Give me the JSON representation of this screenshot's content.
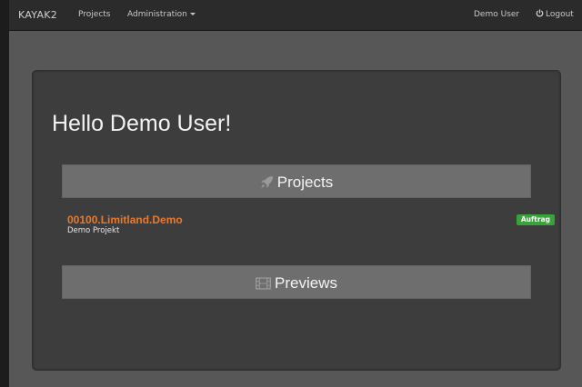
{
  "navbar": {
    "brand": "KAYAK2",
    "links": {
      "projects": "Projects",
      "administration": "Administration"
    },
    "user": "Demo User",
    "logout": "Logout"
  },
  "main": {
    "greeting": "Hello Demo User!",
    "projects_section": {
      "label": "Projects",
      "icon": "rocket-icon"
    },
    "projects": [
      {
        "title": "00100.Limitland.Demo",
        "subtitle": "Demo Projekt",
        "status": "Auftrag"
      }
    ],
    "previews_section": {
      "label": "Previews",
      "icon": "film-icon"
    }
  },
  "colors": {
    "navbar_bg": "#2b2b2b",
    "page_bg": "#575757",
    "panel_bg": "#3d3d3d",
    "section_header_bg": "#6e6e6e",
    "project_link": "#e87a2e",
    "badge_success": "#3aa23a"
  }
}
